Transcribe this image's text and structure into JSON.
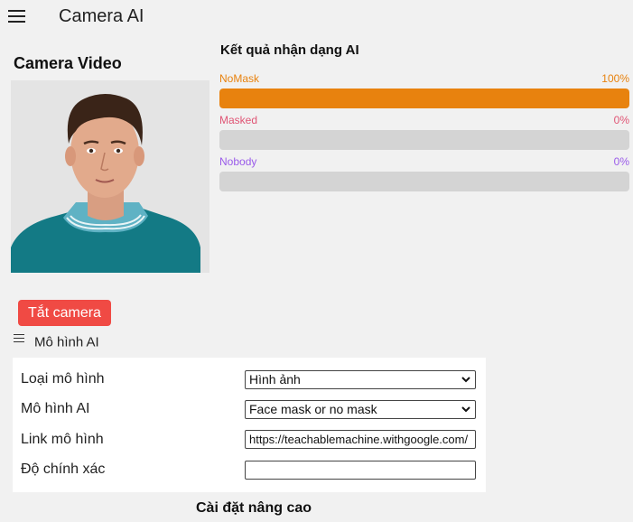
{
  "header": {
    "title": "Camera AI",
    "menu_icon": "hamburger-menu-icon"
  },
  "video": {
    "title": "Camera Video",
    "image": "person-portrait-photo"
  },
  "results": {
    "title": "Kết quả nhận dạng AI",
    "items": [
      {
        "label": "NoMask",
        "percent_text": "100%",
        "value": 1.0,
        "color": "#e8820e"
      },
      {
        "label": "Masked",
        "percent_text": "0%",
        "value": 0.0,
        "color": "#e05575"
      },
      {
        "label": "Nobody",
        "percent_text": "0%",
        "value": 0.0,
        "color": "#9a5bea"
      }
    ]
  },
  "camera_button": {
    "label": "Tắt camera",
    "color": "#f04a44"
  },
  "model_section": {
    "toggle_label": "Mô hình AI",
    "toggle_icon": "list-icon",
    "fields": {
      "model_type": {
        "label": "Loại mô hình",
        "value": "Hình ảnh"
      },
      "ai_model": {
        "label": "Mô hình AI",
        "value": "Face mask or no mask"
      },
      "model_link": {
        "label": "Link mô hình",
        "value": "https://teachablemachine.withgoogle.com/"
      },
      "accuracy": {
        "label": "Độ chính xác",
        "value": ""
      }
    }
  },
  "advanced": {
    "label": "Cài đặt nâng cao"
  }
}
